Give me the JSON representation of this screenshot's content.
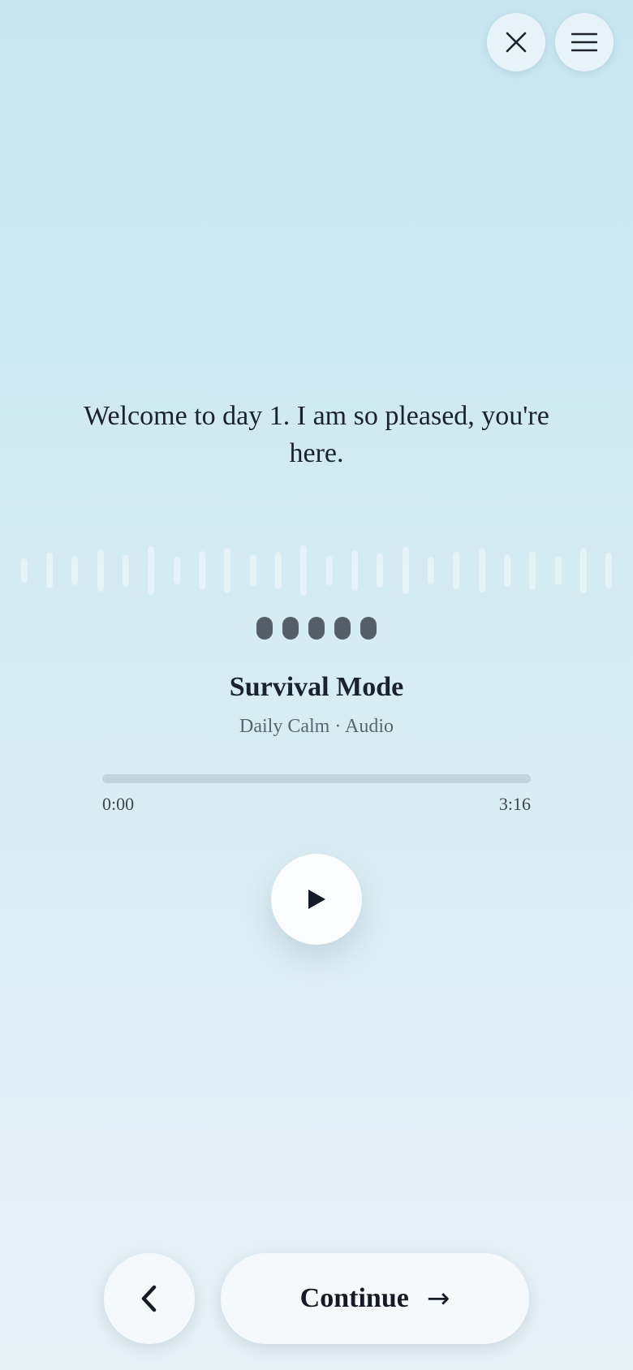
{
  "header": {
    "close_icon": "close-icon",
    "menu_icon": "hamburger-menu-icon"
  },
  "message": {
    "text": "Welcome to day 1. I am so pleased, you're here."
  },
  "player": {
    "title": "Survival Mode",
    "subtitle": "Daily Calm · Audio",
    "current_time": "0:00",
    "duration": "3:16",
    "progress_fraction": 0,
    "play_icon": "play-icon"
  },
  "footer": {
    "back_icon": "chevron-left-icon",
    "continue_label": "Continue",
    "continue_arrow": "→"
  },
  "colors": {
    "background_top": "#c6e5ef",
    "background_bottom": "#e6f1f6",
    "dot": "#545d68",
    "text": "#1a2230"
  }
}
